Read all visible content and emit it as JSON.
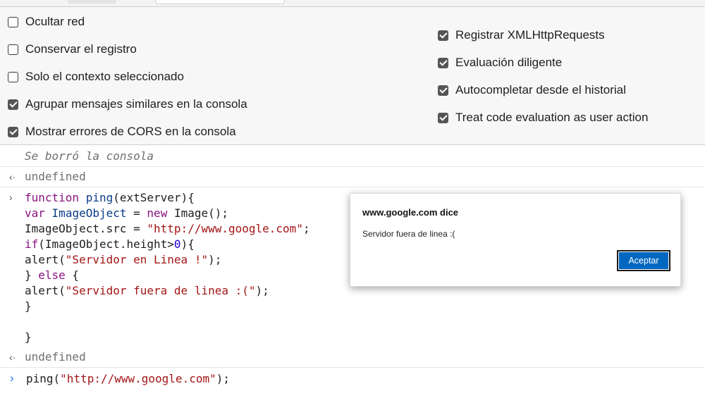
{
  "settings": {
    "left": [
      {
        "label": "Ocultar red",
        "checked": false
      },
      {
        "label": "Conservar el registro",
        "checked": false
      },
      {
        "label": "Solo el contexto seleccionado",
        "checked": false
      },
      {
        "label": "Agrupar mensajes similares en la consola",
        "checked": true
      },
      {
        "label": "Mostrar errores de CORS en la consola",
        "checked": true
      }
    ],
    "right": [
      {
        "label": "Registrar XMLHttpRequests",
        "checked": true
      },
      {
        "label": "Evaluación diligente",
        "checked": true
      },
      {
        "label": "Autocompletar desde el historial",
        "checked": true
      },
      {
        "label": "Treat code evaluation as user action",
        "checked": true
      }
    ]
  },
  "console": {
    "cleared_message": "Se borró la consola",
    "result_1": "undefined",
    "code": {
      "l1_kw": "function",
      "l1_fn": "ping",
      "l1_rest": "(extServer){",
      "l2_kw": "var",
      "l2_name": "ImageObject",
      "l2_eq": " = ",
      "l2_new": "new",
      "l2_rest": " Image();",
      "l3_pre": "ImageObject.src = ",
      "l3_str": "\"http://www.google.com\"",
      "l3_post": ";",
      "l4_kw": "if",
      "l4_mid": "(ImageObject.height>",
      "l4_num": "0",
      "l4_post": "){",
      "l5_pre": "alert(",
      "l5_str": "\"Servidor en Linea !\"",
      "l5_post": ");",
      "l6_pre": "} ",
      "l6_kw": "else",
      "l6_post": " {",
      "l7_pre": "alert(",
      "l7_str": "\"Servidor fuera de linea :(\"",
      "l7_post": ");",
      "l8": "}",
      "l9": "}"
    },
    "result_2": "undefined",
    "input": {
      "fn": "ping(",
      "str": "\"http://www.google.com\"",
      "post": ");"
    }
  },
  "dialog": {
    "title": "www.google.com dice",
    "message": "Servidor fuera de linea :(",
    "ok_label": "Aceptar"
  }
}
